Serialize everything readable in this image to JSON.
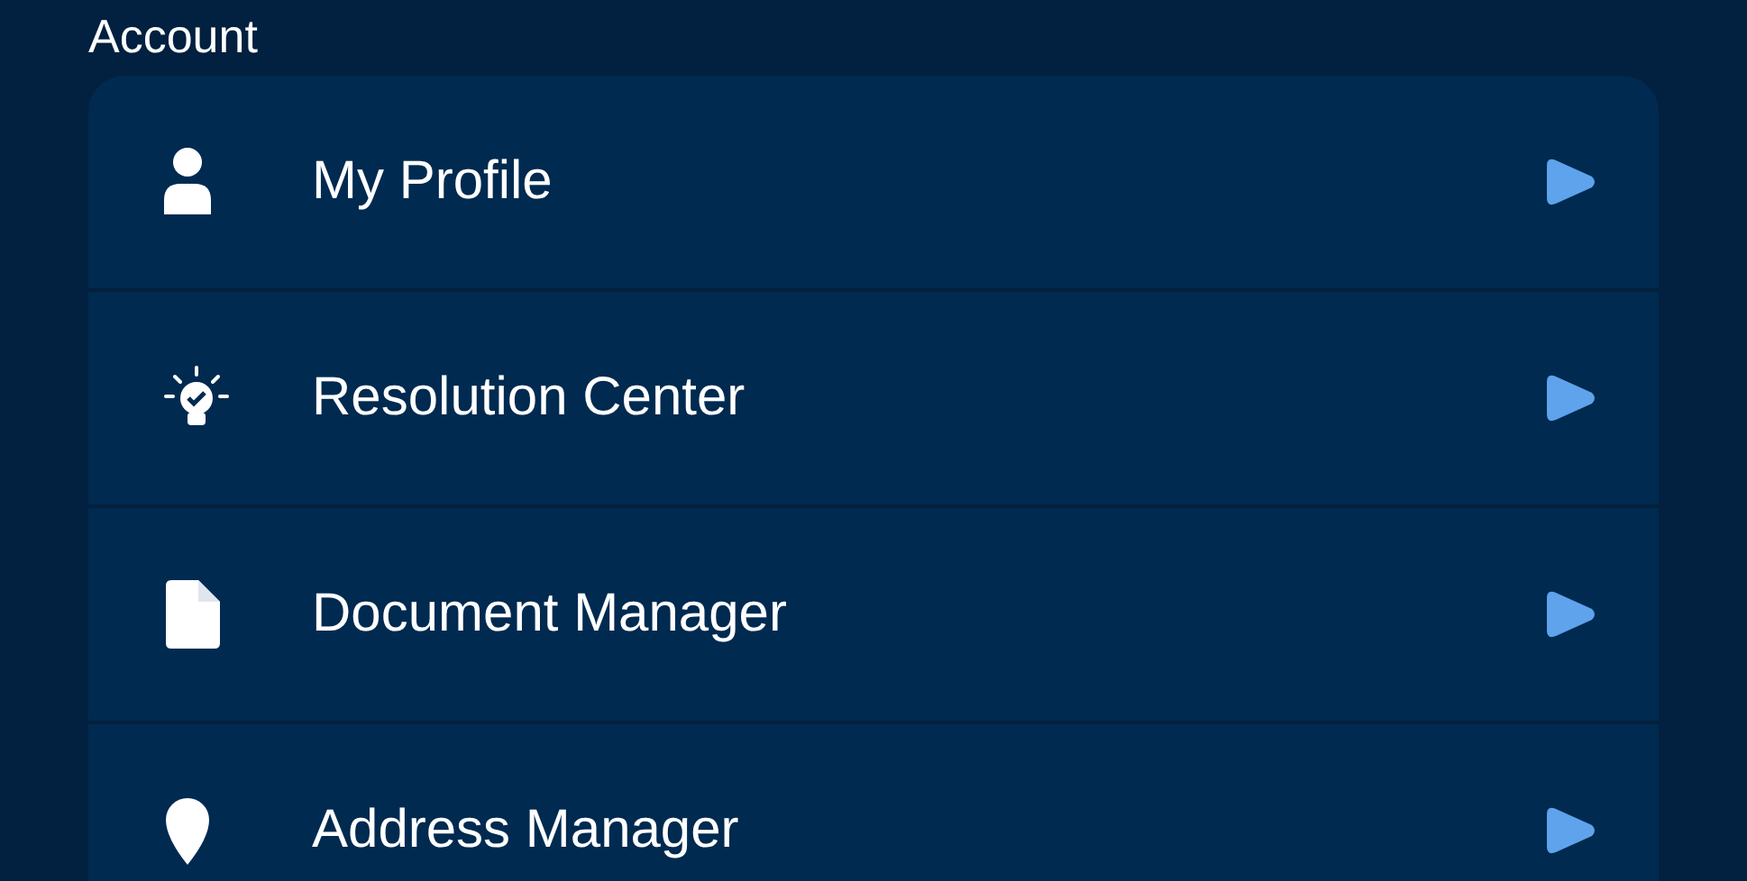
{
  "section_title": "Account",
  "items": [
    {
      "kind": "person",
      "label": "My Profile"
    },
    {
      "kind": "bulb",
      "label": "Resolution Center"
    },
    {
      "kind": "document",
      "label": "Document Manager"
    },
    {
      "kind": "pin",
      "label": "Address Manager"
    }
  ]
}
